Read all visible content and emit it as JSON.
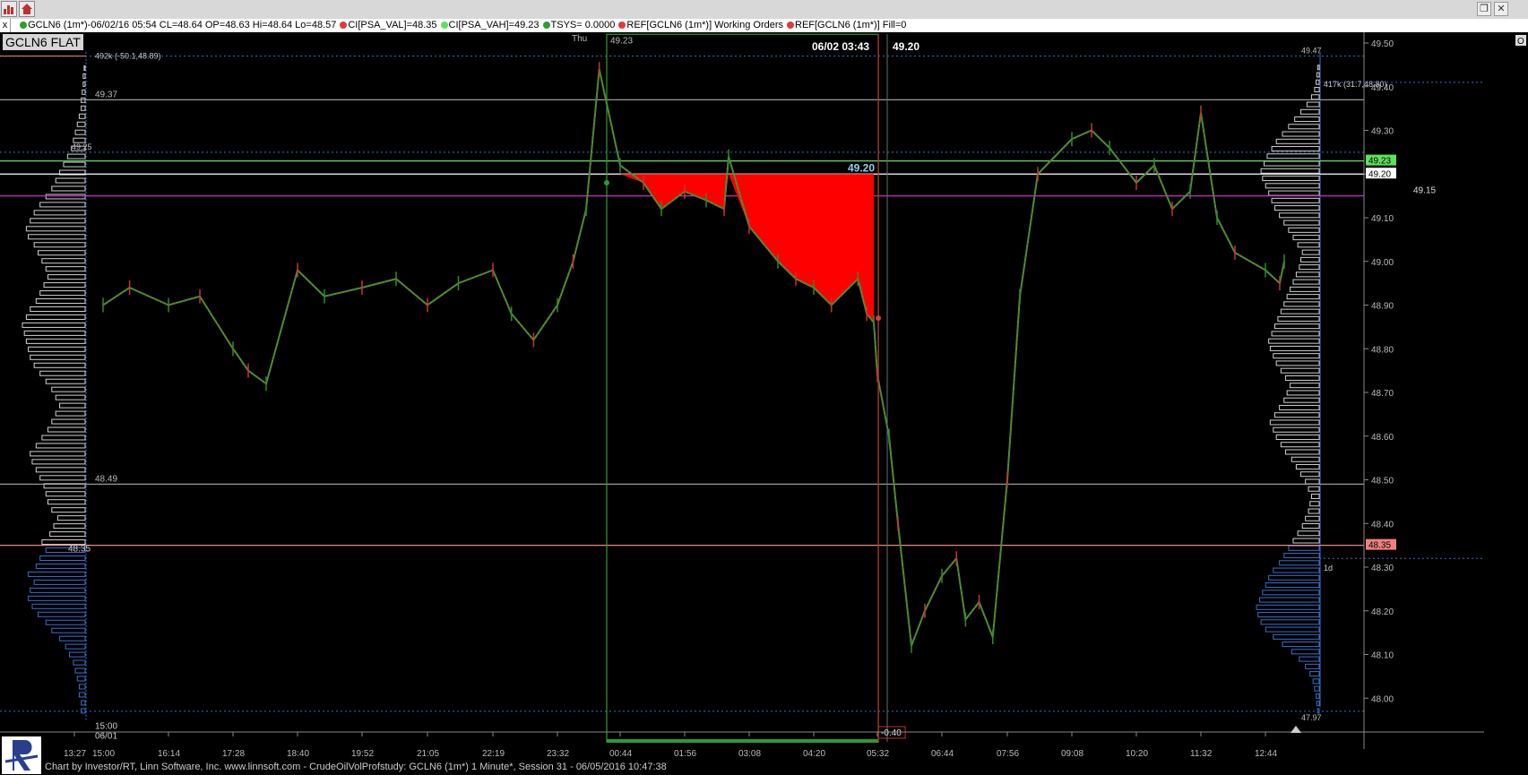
{
  "window": {
    "restore_glyph": "❐",
    "close_glyph": "✕"
  },
  "toolbar": {
    "buttons": [
      {
        "name": "chart-icon"
      },
      {
        "name": "home-icon"
      }
    ]
  },
  "infobar": {
    "close_label": "x",
    "items": [
      {
        "color": "#2c9f2c",
        "text": "GCLN6 (1m*)-06/02/16 05:54 CL=48.64 OP=48.63 Hi=48.64 Lo=48.57"
      },
      {
        "color": "#e03a3a",
        "text": "CI[PSA_VAL]=48.35"
      },
      {
        "color": "#5fe05f",
        "text": "CI[PSA_VAH]=49.23"
      },
      {
        "color": "#2c9f2c",
        "text": "TSYS=  0.0000"
      },
      {
        "color": "#e03a3a",
        "text": "REF[GCLN6 (1m*)] Working Orders"
      },
      {
        "color": "#e03a3a",
        "text": "REF[GCLN6 (1m*)] Fill=0"
      }
    ]
  },
  "symbol_label": "GCLN6 FLAT",
  "footer": "Chart by Investor/RT, Linn Software, Inc. www.linnsoft.com - CrudeOilVolProfstudy: GCLN6 (1m*) 1 Minute*, Session 31 - 06/05/2016 10:47:38",
  "chart_data": {
    "type": "candlestick",
    "symbol": "GCLN6",
    "interval": "1 Minute",
    "ylim": [
      47.91,
      49.52
    ],
    "y_ticks": [
      "49.50",
      "49.40",
      "49.30",
      "49.20",
      "49.10",
      "49.00",
      "48.90",
      "48.80",
      "48.70",
      "48.60",
      "48.50",
      "48.40",
      "48.30",
      "48.20",
      "48.10",
      "48.00"
    ],
    "x_ticks": [
      "13:27",
      "15:00",
      "16:14",
      "17:28",
      "18:40",
      "19:52",
      "21:05",
      "22:19",
      "23:32",
      "00:44",
      "01:56",
      "03:08",
      "04:20",
      "05:32",
      "06:44",
      "07:56",
      "09:08",
      "10:20",
      "11:32",
      "12:44"
    ],
    "session_labels": {
      "day": "Thu",
      "start_time": "15:00",
      "start_date": "06/01"
    },
    "price_series": {
      "x": [
        "15:00",
        "15:30",
        "16:14",
        "16:50",
        "17:28",
        "17:45",
        "18:05",
        "18:40",
        "19:10",
        "19:52",
        "20:30",
        "21:05",
        "21:40",
        "22:19",
        "22:40",
        "23:05",
        "23:32",
        "23:50",
        "00:05",
        "00:20",
        "00:44",
        "01:10",
        "01:30",
        "01:56",
        "02:20",
        "02:40",
        "02:45",
        "03:08",
        "03:40",
        "04:00",
        "04:20",
        "04:40",
        "05:10",
        "05:20",
        "05:28",
        "05:32",
        "05:45",
        "05:55",
        "06:10",
        "06:25",
        "06:44",
        "07:00",
        "07:10",
        "07:25",
        "07:40",
        "07:56",
        "08:10",
        "08:30",
        "09:08",
        "09:30",
        "09:50",
        "10:20",
        "10:40",
        "11:00",
        "11:20",
        "11:32",
        "11:50",
        "12:10",
        "12:44",
        "13:00",
        "13:05"
      ],
      "close": [
        48.9,
        48.94,
        48.9,
        48.92,
        48.8,
        48.75,
        48.72,
        48.98,
        48.92,
        48.94,
        48.96,
        48.9,
        48.95,
        48.98,
        48.88,
        48.82,
        48.9,
        49.0,
        49.12,
        49.44,
        49.22,
        49.18,
        49.12,
        49.16,
        49.14,
        49.12,
        49.24,
        49.08,
        49.0,
        48.96,
        48.94,
        48.9,
        48.96,
        48.88,
        48.86,
        48.74,
        48.6,
        48.4,
        48.12,
        48.2,
        48.28,
        48.32,
        48.18,
        48.22,
        48.14,
        48.5,
        48.92,
        49.2,
        49.28,
        49.3,
        49.26,
        49.18,
        49.22,
        49.12,
        49.16,
        49.34,
        49.1,
        49.02,
        48.98,
        48.95,
        49.0
      ]
    },
    "value_area_shading": {
      "color": "#ff0000",
      "level": 49.2,
      "x_start": "00:44",
      "x_end": "05:28"
    },
    "horizontal_levels": [
      {
        "value": 49.47,
        "label": "49.47",
        "color": "#3a6fc4",
        "style": "dotted"
      },
      {
        "value": 49.37,
        "label": "49.37",
        "color": "#9a9a9a",
        "style": "solid"
      },
      {
        "value": 49.25,
        "label": "49.25",
        "color": "#3a6fc4",
        "style": "dotted"
      },
      {
        "value": 49.23,
        "label": "49.23",
        "color": "#5fe05f",
        "style": "solid"
      },
      {
        "value": 49.2,
        "label": "49.20",
        "color": "#ffffff",
        "style": "solid"
      },
      {
        "value": 49.15,
        "label": "49.15",
        "color": "#c030c0",
        "style": "solid"
      },
      {
        "value": 48.49,
        "label": "48.49",
        "color": "#9a9a9a",
        "style": "solid"
      },
      {
        "value": 48.35,
        "label": "48.35",
        "color": "#f08080",
        "style": "solid"
      },
      {
        "value": 47.97,
        "label": "47.97",
        "color": "#3a6fc4",
        "style": "dotted"
      }
    ],
    "price_tags": [
      {
        "value": 49.23,
        "label": "49.23",
        "bg": "#5fe05f",
        "fg": "#000000"
      },
      {
        "value": 49.2,
        "label": "49.20",
        "bg": "#ffffff",
        "fg": "#000000"
      },
      {
        "value": 48.35,
        "label": "48.35",
        "bg": "#f08080",
        "fg": "#000000"
      }
    ],
    "annotations": {
      "left_profile_info": "492k (-50.1,48.89)",
      "right_profile_info": "417k (31.7,48.80)",
      "right_profile_period": "1d",
      "left_val_label": "48.35",
      "crosshair_time": "06/02 03:43",
      "crosshair_price": "49.20",
      "mid_price_label": "49.20",
      "box_top_label": "49.23",
      "box_bottom_label": "-0.40"
    },
    "left_profile": {
      "price_step": 0.02,
      "volumes": [
        4,
        4,
        6,
        6,
        8,
        10,
        12,
        16,
        20,
        26,
        34,
        40,
        48,
        54,
        58,
        56,
        52,
        58,
        50,
        46,
        40,
        44,
        36,
        32,
        28,
        34,
        38,
        40,
        42,
        46,
        50,
        54,
        56,
        50,
        44,
        38,
        34,
        30,
        26,
        30,
        34,
        40,
        46,
        52,
        56,
        58,
        60,
        62,
        64,
        60,
        56,
        50,
        46,
        42,
        38,
        40,
        44,
        48,
        52,
        58,
        60,
        56,
        52,
        46,
        40,
        34,
        30,
        26,
        22,
        18,
        14,
        12,
        10,
        8,
        6,
        4,
        4,
        3,
        2,
        2,
        1
      ]
    },
    "right_profile": {
      "price_step": 0.02,
      "volumes": [
        2,
        3,
        4,
        6,
        8,
        12,
        18,
        26,
        36,
        48,
        60,
        70,
        76,
        80,
        82,
        78,
        74,
        70,
        66,
        60,
        52,
        46,
        40,
        34,
        28,
        22,
        18,
        14,
        12,
        10,
        14,
        18,
        24,
        30,
        36,
        44,
        50,
        56,
        60,
        64,
        58,
        52,
        46,
        42,
        38,
        44,
        50,
        56,
        60,
        64,
        66,
        62,
        58,
        54,
        50,
        46,
        42,
        38,
        34,
        30,
        26,
        24,
        22,
        28,
        34,
        40,
        46,
        52,
        58,
        62,
        66,
        70,
        74,
        76,
        72,
        68,
        62,
        56,
        48,
        40,
        32,
        24,
        16,
        10,
        6,
        4,
        3,
        2
      ]
    }
  }
}
